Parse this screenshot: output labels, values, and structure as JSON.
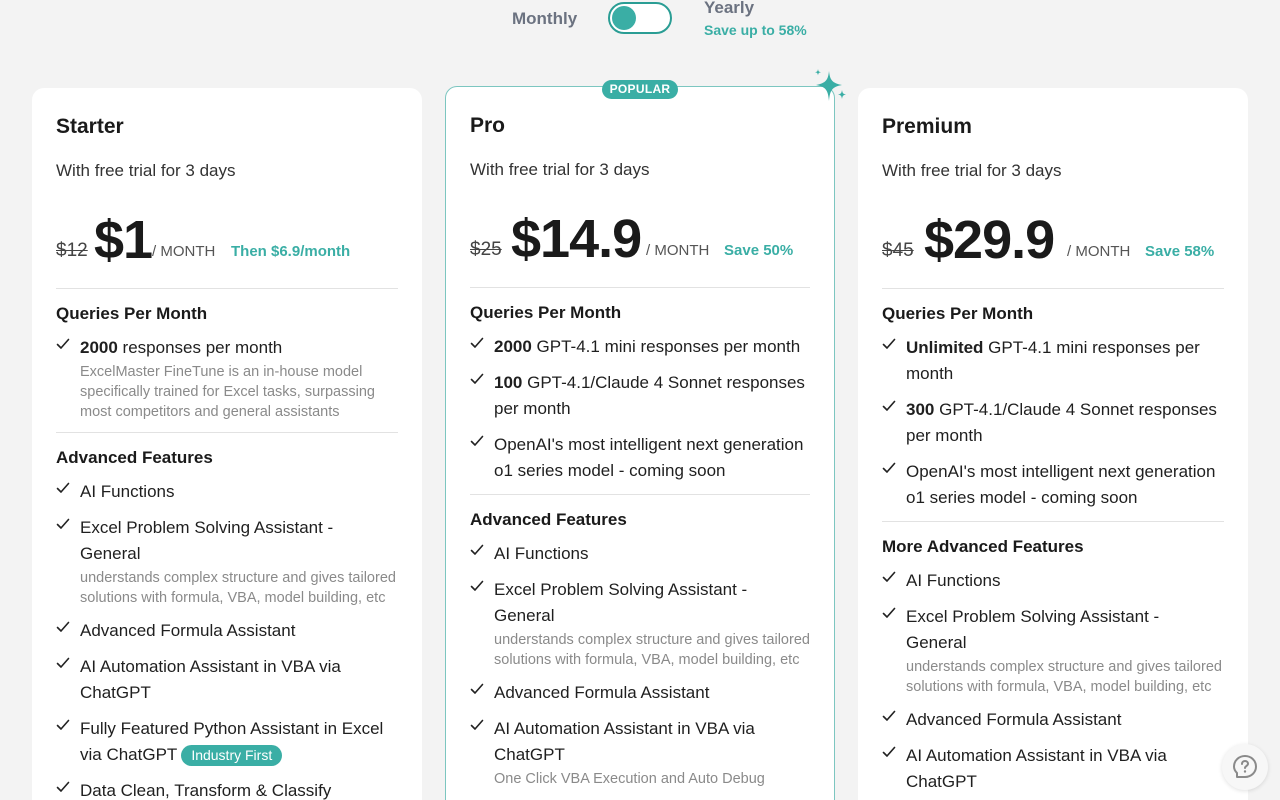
{
  "billing": {
    "monthly_label": "Monthly",
    "yearly_label": "Yearly",
    "yearly_save": "Save up to 58%",
    "toggle_state": "monthly"
  },
  "accent_color": "#3aaea5",
  "starter": {
    "name": "Starter",
    "subtitle": "With free trial for 3 days",
    "old_price": "$12",
    "price": "$1",
    "unit": "/ MONTH",
    "note": "Then $6.9/month",
    "sections": [
      {
        "title": "Queries Per Month",
        "items": [
          {
            "bold": "2000",
            "text": " responses per month",
            "desc": "ExcelMaster FineTune is an in-house model specifically trained for Excel tasks, surpassing most competitors and general assistants"
          }
        ]
      },
      {
        "title": "Advanced Features",
        "items": [
          {
            "bold": "",
            "text": "AI Functions",
            "desc": ""
          },
          {
            "bold": "",
            "text": "Excel Problem Solving Assistant - General",
            "desc": "understands complex structure and gives tailored solutions with formula, VBA, model building, etc"
          },
          {
            "bold": "",
            "text": "Advanced Formula Assistant",
            "desc": ""
          },
          {
            "bold": "",
            "text": "AI Automation Assistant in VBA via ChatGPT",
            "desc": ""
          },
          {
            "bold": "",
            "text": "Fully Featured Python Assistant in Excel via ChatGPT",
            "desc": "",
            "badge": "Industry First"
          },
          {
            "bold": "",
            "text": "Data Clean, Transform & Classify",
            "desc": ""
          }
        ]
      }
    ]
  },
  "pro": {
    "badge": "POPULAR",
    "name": "Pro",
    "subtitle": "With free trial for 3 days",
    "old_price": "$25",
    "price": "$14.9",
    "unit": "/ MONTH",
    "note": "Save 50%",
    "sections": [
      {
        "title": "Queries Per Month",
        "items": [
          {
            "bold": "2000",
            "text": " GPT-4.1 mini responses per month",
            "desc": ""
          },
          {
            "bold": "100",
            "text": " GPT-4.1/Claude 4 Sonnet responses per month",
            "desc": ""
          },
          {
            "bold": "",
            "text": "OpenAI's most intelligent next generation o1 series model - coming soon",
            "desc": ""
          }
        ]
      },
      {
        "title": "Advanced Features",
        "items": [
          {
            "bold": "",
            "text": "AI Functions",
            "desc": ""
          },
          {
            "bold": "",
            "text": "Excel Problem Solving Assistant - General",
            "desc": "understands complex structure and gives tailored solutions with formula, VBA, model building, etc"
          },
          {
            "bold": "",
            "text": "Advanced Formula Assistant",
            "desc": ""
          },
          {
            "bold": "",
            "text": "AI Automation Assistant in VBA via ChatGPT",
            "desc": "One Click VBA Execution and Auto Debug"
          }
        ]
      }
    ]
  },
  "premium": {
    "name": "Premium",
    "subtitle": "With free trial for 3 days",
    "old_price": "$45",
    "price": "$29.9",
    "unit": "/ MONTH",
    "note": "Save 58%",
    "sections": [
      {
        "title": "Queries Per Month",
        "items": [
          {
            "bold": "Unlimited",
            "text": " GPT-4.1 mini responses per month",
            "desc": ""
          },
          {
            "bold": "300",
            "text": " GPT-4.1/Claude 4 Sonnet responses per month",
            "desc": ""
          },
          {
            "bold": "",
            "text": "OpenAI's most intelligent next generation o1 series model - coming soon",
            "desc": ""
          }
        ]
      },
      {
        "title": "More Advanced Features",
        "items": [
          {
            "bold": "",
            "text": "AI Functions",
            "desc": ""
          },
          {
            "bold": "",
            "text": "Excel Problem Solving Assistant - General",
            "desc": "understands complex structure and gives tailored solutions with formula, VBA, model building, etc"
          },
          {
            "bold": "",
            "text": "Advanced Formula Assistant",
            "desc": ""
          },
          {
            "bold": "",
            "text": "AI Automation Assistant in VBA via ChatGPT",
            "desc": ""
          }
        ]
      }
    ]
  },
  "help": {
    "icon": "help-chat-icon"
  }
}
